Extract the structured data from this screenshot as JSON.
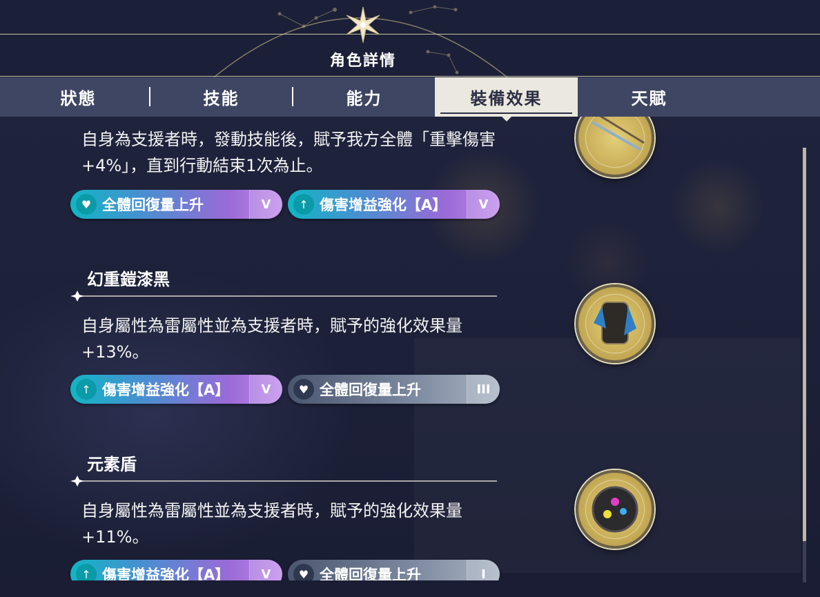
{
  "header": {
    "title": "角色詳情"
  },
  "tabs": [
    {
      "label": "狀態",
      "active": false
    },
    {
      "label": "技能",
      "active": false
    },
    {
      "label": "能力",
      "active": false
    },
    {
      "label": "裝備效果",
      "active": true
    },
    {
      "label": "天賦",
      "active": false
    }
  ],
  "items": [
    {
      "name": "",
      "desc_line1": "自身為支援者時，發動技能後，賦予我方全體「重擊傷害",
      "desc_line2": "+4%」，直到行動結束1次為止。",
      "tags": [
        {
          "label": "全體回復量上升",
          "rank": "V",
          "style": "purple",
          "icon": "heart-up-icon"
        },
        {
          "label": "傷害增益強化【A】",
          "rank": "V",
          "style": "purple",
          "icon": "arrow-up-icon"
        }
      ],
      "medal": "weapon-medal"
    },
    {
      "name": "幻重鎧漆黑",
      "desc_line1": "自身屬性為雷屬性並為支援者時，賦予的強化效果量",
      "desc_line2": "+13%。",
      "tags": [
        {
          "label": "傷害增益強化【A】",
          "rank": "V",
          "style": "purple",
          "icon": "arrow-up-icon"
        },
        {
          "label": "全體回復量上升",
          "rank": "III",
          "style": "grey",
          "icon": "heart-up-icon"
        }
      ],
      "medal": "armor-medal"
    },
    {
      "name": "元素盾",
      "desc_line1": "自身屬性為雷屬性並為支援者時，賦予的強化效果量",
      "desc_line2": "+11%。",
      "tags": [
        {
          "label": "傷害增益強化【A】",
          "rank": "V",
          "style": "purple",
          "icon": "arrow-up-icon"
        },
        {
          "label": "全體回復量上升",
          "rank": "I",
          "style": "grey",
          "icon": "heart-up-icon"
        }
      ],
      "medal": "shield-medal"
    }
  ],
  "colors": {
    "tab_active_bg": "#ebe8df",
    "tab_bar_bg": "#3f4663",
    "tag_purple_start": "#10b6c4",
    "tag_purple_end": "#c18cec",
    "tag_grey": "#7e8aa0",
    "medal_gold": "#c8ad58"
  }
}
